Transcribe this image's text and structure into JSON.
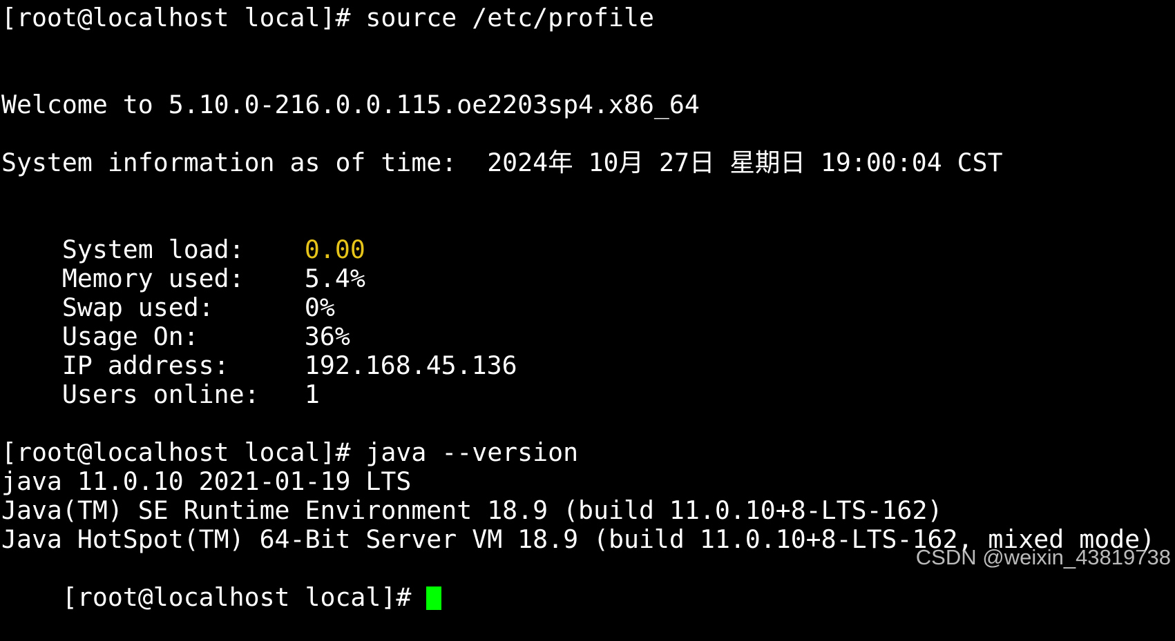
{
  "terminal": {
    "line1": "[root@localhost local]# source /etc/profile",
    "welcome": "Welcome to 5.10.0-216.0.0.115.oe2203sp4.x86_64",
    "sysinfo": "System information as of time:  2024年 10月 27日 星期日 19:00:04 CST",
    "stats": [
      {
        "label": "System load:",
        "value": "0.00"
      },
      {
        "label": "Memory used:",
        "value": "5.4%"
      },
      {
        "label": "Swap used:",
        "value": "0%"
      },
      {
        "label": "Usage On:",
        "value": "36%"
      },
      {
        "label": "IP address:",
        "value": "192.168.45.136"
      },
      {
        "label": "Users online:",
        "value": "1"
      }
    ],
    "cmd2": "[root@localhost local]# java --version",
    "out1": "java 11.0.10 2021-01-19 LTS",
    "out2": "Java(TM) SE Runtime Environment 18.9 (build 11.0.10+8-LTS-162)",
    "out3": "Java HotSpot(TM) 64-Bit Server VM 18.9 (build 11.0.10+8-LTS-162, mixed mode)",
    "prompt": "[root@localhost local]# "
  },
  "watermark": "CSDN @weixin_43819738",
  "colors": {
    "background": "#000000",
    "foreground": "#ffffff",
    "load_value": "#e6c419",
    "cursor": "#00ff00"
  }
}
